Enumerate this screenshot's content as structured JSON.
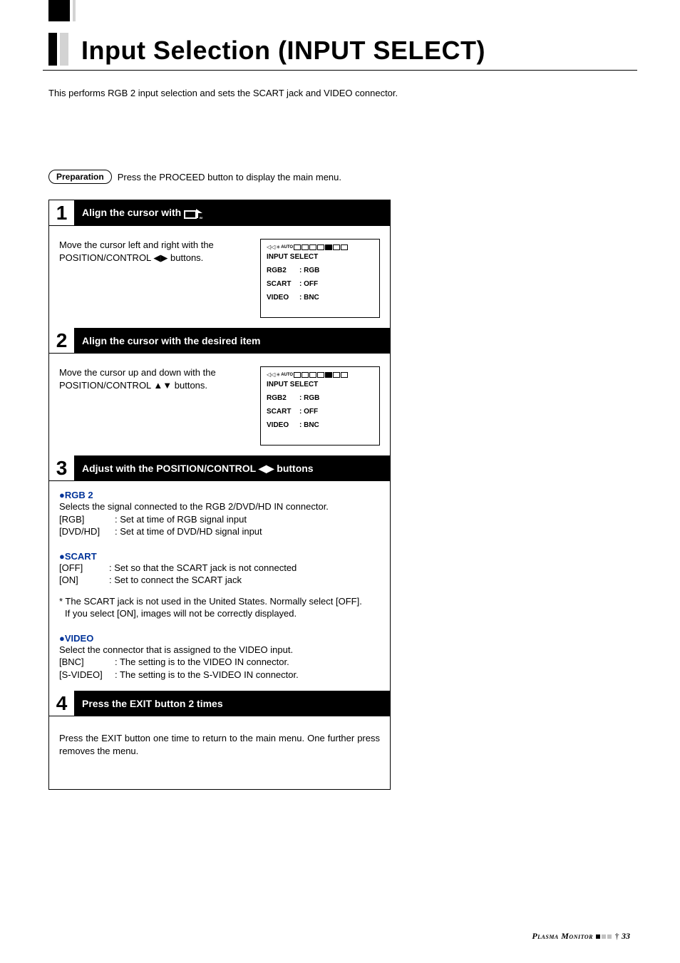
{
  "title": "Input Selection (INPUT SELECT)",
  "intro": "This performs RGB 2 input selection and sets the SCART jack and VIDEO connector.",
  "preparation": {
    "label": "Preparation",
    "text": "Press the PROCEED button to display the main menu."
  },
  "steps": {
    "s1": {
      "num": "1",
      "title_a": "Align the cursor with ",
      "body": "Move the cursor left and right with the POSITION/CONTROL ◀▶ buttons."
    },
    "s2": {
      "num": "2",
      "title": "Align the cursor with the desired item",
      "body": "Move the cursor up and down with the POSITION/CONTROL ▲▼ buttons."
    },
    "s3": {
      "num": "3",
      "title": "Adjust with the POSITION/CONTROL ◀▶ buttons",
      "rgb2": {
        "head": "●RGB 2",
        "desc": "Selects the signal connected to the RGB 2/DVD/HD IN connector.",
        "r1k": "[RGB]",
        "r1v": ": Set at time of RGB signal input",
        "r2k": "[DVD/HD]",
        "r2v": ": Set at time of DVD/HD signal input"
      },
      "scart": {
        "head": "●SCART",
        "r1k": "[OFF]",
        "r1v": ": Set so that the SCART jack is not connected",
        "r2k": "[ON]",
        "r2v": ": Set to connect the SCART jack",
        "note1": "* The SCART jack is not used in the United States. Normally select [OFF].",
        "note2": "If you select [ON], images will not be correctly displayed."
      },
      "video": {
        "head": "●VIDEO",
        "desc": "Select the connector that is assigned to the VIDEO input.",
        "r1k": "[BNC]",
        "r1v": ": The setting is to the VIDEO IN connector.",
        "r2k": "[S-VIDEO]",
        "r2v": ": The setting is to the S-VIDEO IN connector."
      }
    },
    "s4": {
      "num": "4",
      "title": "Press the EXIT button 2 times",
      "body": "Press the EXIT button one time to return to the main menu. One further press removes the menu."
    }
  },
  "osd": {
    "title": "INPUT SELECT",
    "rows": [
      {
        "k": "RGB2",
        "v": ": RGB"
      },
      {
        "k": "SCART",
        "v": ": OFF"
      },
      {
        "k": "VIDEO",
        "v": ": BNC"
      }
    ]
  },
  "footer": {
    "pm": "Plasma Monitor",
    "pn": "33"
  }
}
